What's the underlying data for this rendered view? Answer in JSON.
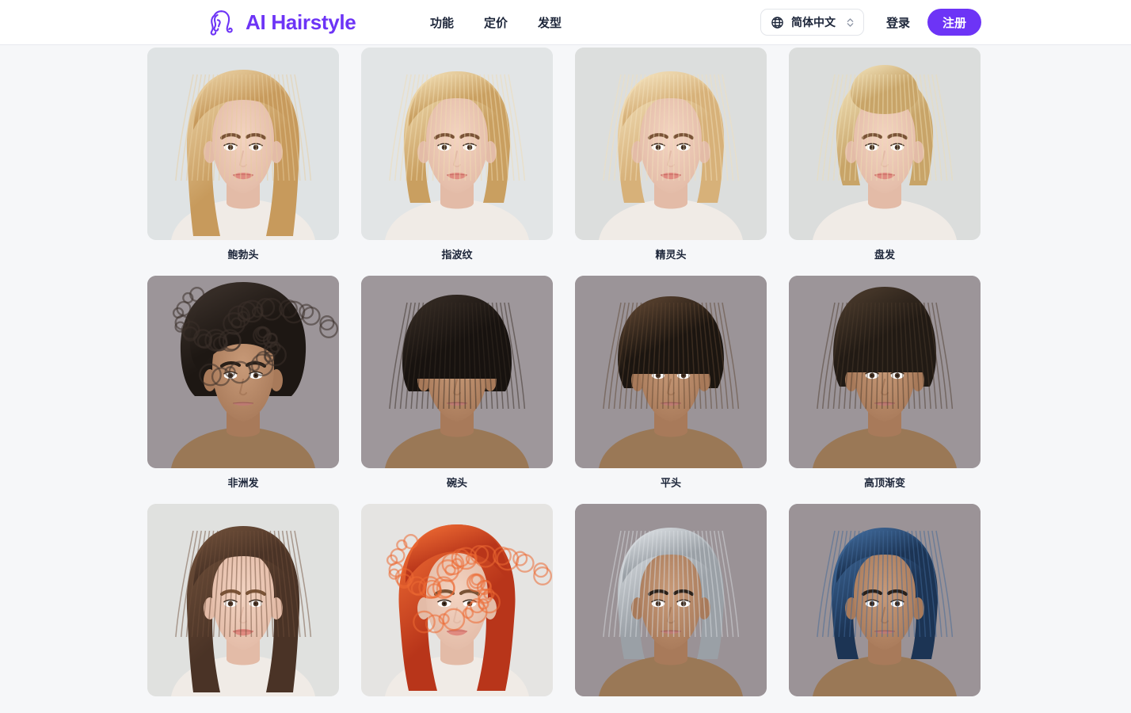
{
  "header": {
    "brand_name": "AI Hairstyle",
    "logo_icon": "hair-silhouette-icon",
    "brand_color": "#6d34f6",
    "nav": [
      {
        "label": "功能",
        "name": "features"
      },
      {
        "label": "定价",
        "name": "pricing"
      },
      {
        "label": "发型",
        "name": "hairstyles"
      }
    ],
    "language_selector": {
      "icon": "globe-icon",
      "value": "简体中文",
      "chevron_icon": "chevron-up-down-icon"
    },
    "login_label": "登录",
    "signup_label": "注册",
    "signup_color": "#6d34f6",
    "background": "#ffffff",
    "border_color": "#e7e9ee"
  },
  "gallery": {
    "page_background": "#f6f7f9",
    "columns": 4,
    "cards": [
      {
        "label": "鲍勃头",
        "subject": "female",
        "hair": "#c79a5c",
        "hair_light": "#e8ceA0",
        "bg": "#dfe3e4",
        "length": "medium",
        "photo": "blonde-bob"
      },
      {
        "label": "指波纹",
        "subject": "female",
        "hair": "#c99f60",
        "hair_light": "#f0dcb2",
        "bg": "#e2e5e6",
        "length": "short",
        "photo": "finger-waves"
      },
      {
        "label": "精灵头",
        "subject": "female",
        "hair": "#d7b179",
        "hair_light": "#f2e0bb",
        "bg": "#dcdedd",
        "length": "pixie",
        "photo": "pixie-cut"
      },
      {
        "label": "盘发",
        "subject": "female",
        "hair": "#c8a468",
        "hair_light": "#eeddb4",
        "bg": "#dbdddc",
        "length": "updo",
        "photo": "updo"
      },
      {
        "label": "非洲发",
        "subject": "male",
        "hair": "#1d1713",
        "hair_light": "#3a302a",
        "bg": "#9c9599",
        "length": "afro",
        "photo": "afro"
      },
      {
        "label": "碗头",
        "subject": "male",
        "hair": "#17120f",
        "hair_light": "#352b24",
        "bg": "#9e979b",
        "length": "bowl",
        "photo": "bowl-cut"
      },
      {
        "label": "平头",
        "subject": "male",
        "hair": "#1b1510",
        "hair_light": "#5b4330",
        "bg": "#9b9498",
        "length": "crew",
        "photo": "crew-cut"
      },
      {
        "label": "高顶渐变",
        "subject": "male",
        "hair": "#211a14",
        "hair_light": "#4a3a2c",
        "bg": "#9c9599",
        "length": "highfade",
        "photo": "high-top-fade"
      },
      {
        "label": "",
        "subject": "female",
        "hair": "#4a3326",
        "hair_light": "#6d4e39",
        "bg": "#e0e1df",
        "length": "long",
        "photo": "brown-long"
      },
      {
        "label": "",
        "subject": "female",
        "hair": "#b8351a",
        "hair_light": "#ed6a33",
        "bg": "#e5e4e2",
        "length": "curly",
        "photo": "red-curly"
      },
      {
        "label": "",
        "subject": "male",
        "hair": "#9aa0a6",
        "hair_light": "#d9dde1",
        "bg": "#9a9296",
        "length": "short",
        "photo": "silver-hair"
      },
      {
        "label": "",
        "subject": "male",
        "hair": "#1c3454",
        "hair_light": "#3f6898",
        "bg": "#9b9397",
        "length": "short",
        "photo": "blue-hair"
      }
    ]
  }
}
